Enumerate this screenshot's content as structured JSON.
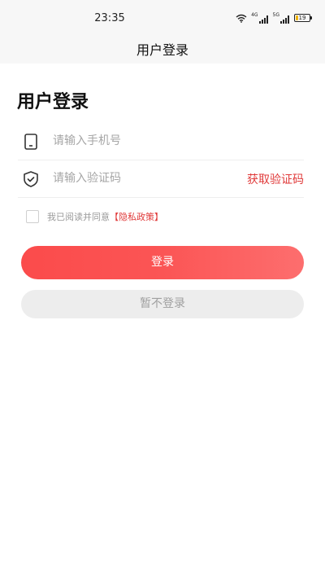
{
  "status_bar": {
    "time": "23:35",
    "signal_1_label": "4G",
    "signal_2_label": "5G",
    "battery_level": "19",
    "battery_fraction": 0.19,
    "battery_color": "#f0b400"
  },
  "title_bar": {
    "title": "用户登录"
  },
  "page": {
    "heading": "用户登录"
  },
  "phone_field": {
    "placeholder": "请输入手机号",
    "value": "",
    "icon": "phone-icon"
  },
  "code_field": {
    "placeholder": "请输入验证码",
    "value": "",
    "icon": "shield-check-icon",
    "get_code_label": "获取验证码"
  },
  "agreement": {
    "checked": false,
    "text": "我已阅读并同意",
    "policy_link": "【隐私政策】"
  },
  "buttons": {
    "login_label": "登录",
    "skip_label": "暂不登录"
  },
  "colors": {
    "accent": "#e03a3a",
    "login_gradient_start": "#fb4b4b",
    "login_gradient_end": "#fd6e6e",
    "skip_bg": "#ededed"
  }
}
